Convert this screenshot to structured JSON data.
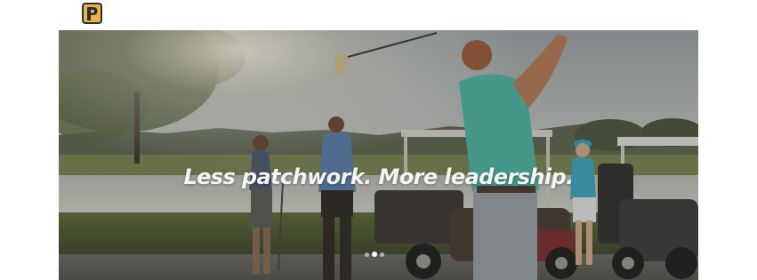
{
  "header": {
    "logo_icon": "patchwork-p-logo-icon",
    "logo_colors": {
      "fill": "#f2b23b",
      "outline": "#1f2f47"
    }
  },
  "hero": {
    "image_description_icon": "golf-course-photo",
    "tagline": "Less patchwork. More leadership.",
    "carousel": {
      "slide_count": 3,
      "active_index": 1
    }
  }
}
